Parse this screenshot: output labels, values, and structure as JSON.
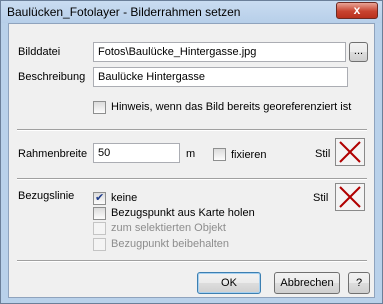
{
  "window": {
    "title": "Baulücken_Fotolayer - Bilderrahmen setzen",
    "close_label": "x"
  },
  "bilddatei": {
    "label": "Bilddatei",
    "value": "Fotos\\Baulücke_Hintergasse.jpg",
    "browse_label": "..."
  },
  "beschreibung": {
    "label": "Beschreibung",
    "value": "Baulücke Hintergasse"
  },
  "hinweis": {
    "label": "Hinweis, wenn das Bild bereits georeferenziert ist",
    "checked": false
  },
  "rahmen": {
    "label": "Rahmenbreite",
    "value": "50",
    "unit": "m",
    "fixieren_label": "fixieren",
    "fixieren_checked": false,
    "stil_label": "Stil",
    "stil_icon": "red-x-icon"
  },
  "bezug": {
    "label": "Bezugslinie",
    "stil_label": "Stil",
    "stil_icon": "red-x-icon",
    "options": [
      {
        "label": "keine",
        "checked": true,
        "enabled": true
      },
      {
        "label": "Bezugspunkt aus Karte holen",
        "checked": false,
        "enabled": true
      },
      {
        "label": "zum selektierten Objekt",
        "checked": false,
        "enabled": false
      },
      {
        "label": "Bezugpunkt beibehalten",
        "checked": false,
        "enabled": false
      }
    ]
  },
  "buttons": {
    "ok": "OK",
    "cancel": "Abbrechen",
    "help": "?"
  },
  "colors": {
    "frame": "#b9d1ea",
    "dialog_bg": "#f0f0f0",
    "close_red": "#c8432f",
    "style_x": "#b00000"
  }
}
